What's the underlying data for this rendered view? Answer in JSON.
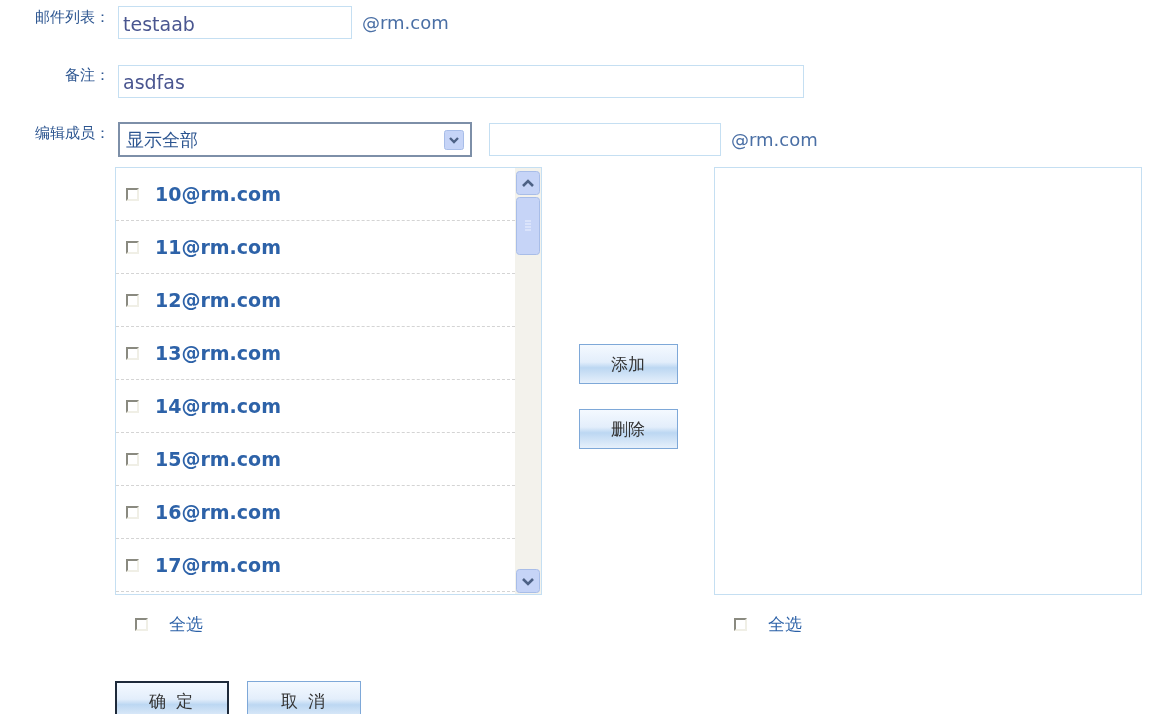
{
  "mail_list": {
    "label": "邮件列表：",
    "value": "testaab",
    "suffix": "@rm.com"
  },
  "note": {
    "label": "备注：",
    "value": "asdfas"
  },
  "edit_members": {
    "label": "编辑成员：",
    "filter": "显示全部",
    "add_field": {
      "suffix": "@rm.com"
    }
  },
  "member_list": {
    "items": [
      {
        "label": "10@rm.com",
        "checked": false
      },
      {
        "label": "11@rm.com",
        "checked": false
      },
      {
        "label": "12@rm.com",
        "checked": false
      },
      {
        "label": "13@rm.com",
        "checked": false
      },
      {
        "label": "14@rm.com",
        "checked": false
      },
      {
        "label": "15@rm.com",
        "checked": false
      },
      {
        "label": "16@rm.com",
        "checked": false
      },
      {
        "label": "17@rm.com",
        "checked": false
      }
    ],
    "select_all": {
      "label": "全选",
      "checked": false
    }
  },
  "move_buttons": [
    "添加",
    "删除"
  ],
  "selected_list": {
    "select_all": {
      "label": "全选",
      "checked": false
    }
  },
  "footer_buttons": [
    {
      "label": "确 定",
      "default": true
    },
    {
      "label": "取 消",
      "default": false
    }
  ]
}
